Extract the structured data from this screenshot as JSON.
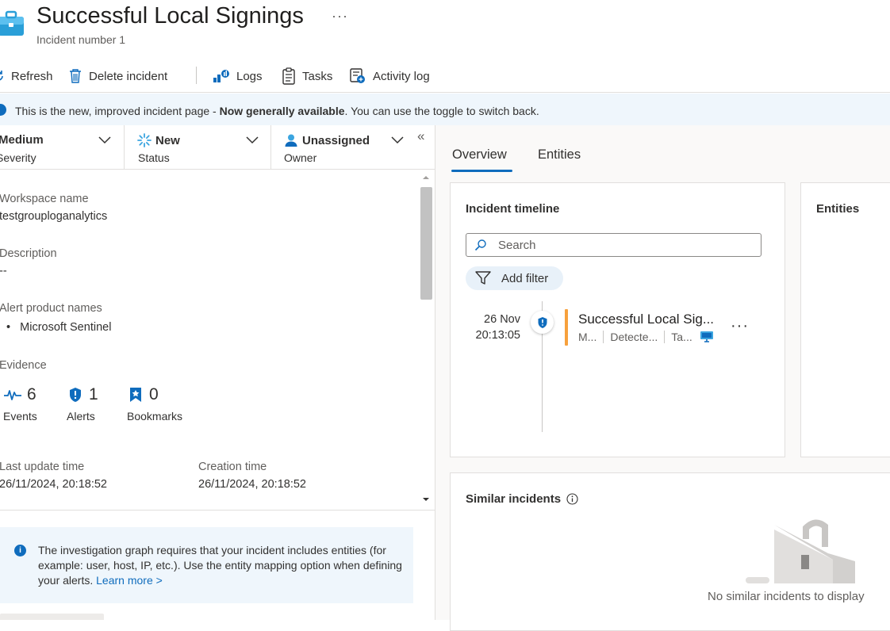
{
  "header": {
    "title": "Successful Local Signings",
    "subtitle": "Incident number 1",
    "more_label": "···"
  },
  "toolbar": {
    "refresh": "Refresh",
    "delete": "Delete incident",
    "logs": "Logs",
    "tasks": "Tasks",
    "activity": "Activity log"
  },
  "banner": {
    "text_prefix": "This is the new, improved incident page - ",
    "text_bold": "Now generally available",
    "text_suffix": ". You can use the toggle to switch back."
  },
  "left": {
    "severity": {
      "value": "Medium",
      "label": "Severity"
    },
    "status": {
      "value": "New",
      "label": "Status"
    },
    "owner": {
      "value": "Unassigned",
      "label": "Owner"
    },
    "collapse_glyph": "«",
    "workspace": {
      "label": "Workspace name",
      "value": "testgrouploganalytics"
    },
    "description": {
      "label": "Description",
      "value": "--"
    },
    "alert_products": {
      "label": "Alert product names",
      "items": [
        "Microsoft Sentinel"
      ]
    },
    "evidence": {
      "label": "Evidence",
      "events": {
        "count": "6",
        "label": "Events"
      },
      "alerts": {
        "count": "1",
        "label": "Alerts"
      },
      "bookmarks": {
        "count": "0",
        "label": "Bookmarks"
      }
    },
    "last_update": {
      "label": "Last update time",
      "value": "26/11/2024, 20:18:52"
    },
    "creation": {
      "label": "Creation time",
      "value": "26/11/2024, 20:18:52"
    },
    "info": {
      "text": "The investigation graph requires that your incident includes entities (for example: user, host, IP, etc.). Use the entity mapping option when defining your alerts.",
      "link": "Learn more >"
    }
  },
  "tabs": [
    {
      "label": "Overview",
      "active": true
    },
    {
      "label": "Entities",
      "active": false
    }
  ],
  "timeline": {
    "title": "Incident timeline",
    "search_placeholder": "Search",
    "add_filter": "Add filter",
    "entry": {
      "date": "26 Nov",
      "time": "20:13:05",
      "title": "Successful Local Sig...",
      "meta1": "M...",
      "meta2": "Detecte...",
      "meta3": "Ta...",
      "more": "···",
      "severity_color": "#f7a13d"
    }
  },
  "entities_card": {
    "title": "Entities"
  },
  "similar": {
    "title": "Similar incidents",
    "empty": "No similar incidents to display"
  },
  "colors": {
    "accent": "#0f6cbd",
    "banner_bg": "#eff6fc",
    "medium_severity": "#f7a13d"
  }
}
